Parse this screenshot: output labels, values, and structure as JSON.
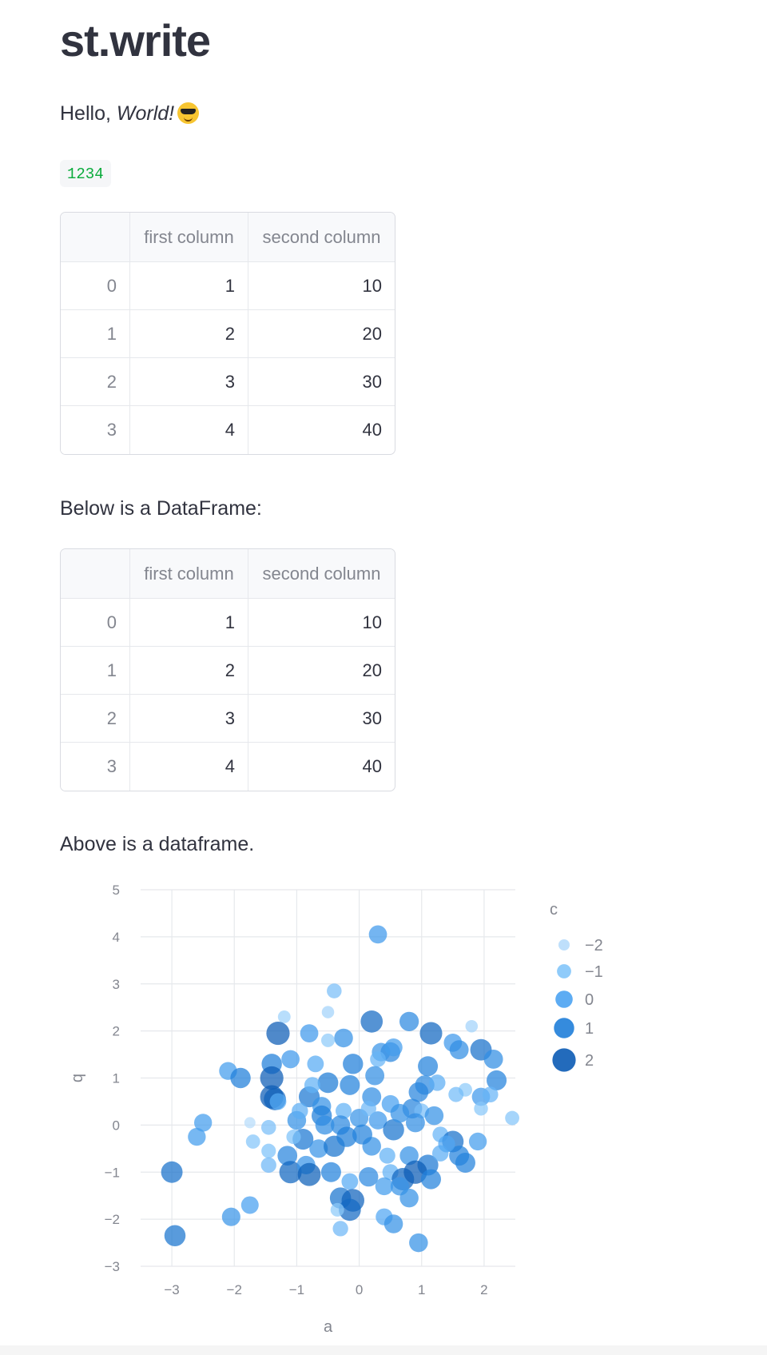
{
  "page": {
    "title": "st.write",
    "hello": {
      "prefix": "Hello, ",
      "italic": "World!"
    },
    "code_value": "1234",
    "caption_below": "Below is a DataFrame:",
    "caption_above": "Above is a dataframe."
  },
  "tables": {
    "columns": [
      "",
      "first column",
      "second column"
    ],
    "rows": [
      {
        "index": "0",
        "first": "1",
        "second": "10"
      },
      {
        "index": "1",
        "first": "2",
        "second": "20"
      },
      {
        "index": "2",
        "first": "3",
        "second": "30"
      },
      {
        "index": "3",
        "first": "4",
        "second": "40"
      }
    ]
  },
  "chart_data": {
    "type": "scatter",
    "xlabel": "a",
    "ylabel": "b",
    "xticks": [
      -3,
      -2,
      -1,
      0,
      1,
      2
    ],
    "yticks": [
      -3,
      -2,
      -1,
      0,
      1,
      2,
      3,
      4,
      5
    ],
    "xlim": [
      -3.5,
      2.5
    ],
    "ylim": [
      -3.0,
      5.0
    ],
    "grid": true,
    "legend": {
      "title": "c",
      "placement": "right",
      "entries": [
        "−2",
        "−1",
        "0",
        "1",
        "2"
      ]
    },
    "colors": {
      "c_minus2": "#b7dcfb",
      "c_minus1": "#83c5fa",
      "c_0": "#4ba3f2",
      "c_1": "#1f7ed9",
      "c_2": "#0b5bb5",
      "grid": "#e6e8ec",
      "axis_text": "#83868f"
    },
    "points": [
      [
        0.3,
        4.05,
        0.3
      ],
      [
        -0.4,
        2.85,
        -0.8
      ],
      [
        -0.5,
        2.4,
        -1.6
      ],
      [
        -1.2,
        2.3,
        -1.5
      ],
      [
        0.2,
        2.2,
        1.6
      ],
      [
        -1.3,
        1.95,
        2.0
      ],
      [
        -0.8,
        1.95,
        0.3
      ],
      [
        -0.25,
        1.85,
        0.5
      ],
      [
        0.8,
        2.2,
        0.7
      ],
      [
        1.15,
        1.95,
        1.7
      ],
      [
        1.8,
        2.1,
        -1.6
      ],
      [
        1.5,
        1.75,
        0.3
      ],
      [
        1.6,
        1.6,
        0.6
      ],
      [
        1.95,
        1.6,
        1.4
      ],
      [
        2.15,
        1.4,
        0.6
      ],
      [
        0.5,
        1.55,
        0.8
      ],
      [
        0.35,
        1.55,
        0.4
      ],
      [
        0.55,
        1.65,
        0.2
      ],
      [
        -0.5,
        1.8,
        -1.2
      ],
      [
        -1.1,
        1.4,
        0.3
      ],
      [
        -0.7,
        1.3,
        -0.2
      ],
      [
        -1.4,
        1.3,
        1.0
      ],
      [
        -0.1,
        1.3,
        1.0
      ],
      [
        0.3,
        1.4,
        -0.5
      ],
      [
        1.1,
        1.25,
        0.9
      ],
      [
        -2.1,
        1.15,
        0.2
      ],
      [
        -1.9,
        1.0,
        1.0
      ],
      [
        -1.4,
        1.0,
        2.0
      ],
      [
        -0.5,
        0.9,
        1.1
      ],
      [
        -0.15,
        0.85,
        0.9
      ],
      [
        0.25,
        1.05,
        0.6
      ],
      [
        1.05,
        0.85,
        0.7
      ],
      [
        1.25,
        0.9,
        -0.3
      ],
      [
        1.7,
        0.75,
        -1.2
      ],
      [
        2.2,
        0.95,
        0.9
      ],
      [
        1.95,
        0.6,
        0.3
      ],
      [
        2.1,
        0.65,
        -0.5
      ],
      [
        1.55,
        0.65,
        -0.7
      ],
      [
        -1.35,
        0.55,
        1.6
      ],
      [
        -1.4,
        0.6,
        2.2
      ],
      [
        -1.3,
        0.5,
        -0.2
      ],
      [
        -0.8,
        0.6,
        1.2
      ],
      [
        -0.6,
        0.4,
        0.5
      ],
      [
        -0.25,
        0.3,
        -0.4
      ],
      [
        0.2,
        0.6,
        0.6
      ],
      [
        0.5,
        0.45,
        0.1
      ],
      [
        0.85,
        0.35,
        0.8
      ],
      [
        1.0,
        0.3,
        -0.8
      ],
      [
        1.2,
        0.2,
        0.5
      ],
      [
        1.95,
        0.35,
        -1.1
      ],
      [
        2.45,
        0.15,
        -1.0
      ],
      [
        -2.5,
        0.05,
        0.2
      ],
      [
        -2.6,
        -0.25,
        0.2
      ],
      [
        -1.45,
        -0.05,
        -0.8
      ],
      [
        -1.75,
        0.05,
        -2.0
      ],
      [
        -1.0,
        0.1,
        0.5
      ],
      [
        -0.6,
        0.2,
        1.0
      ],
      [
        -0.3,
        0.0,
        0.7
      ],
      [
        0.0,
        0.15,
        0.4
      ],
      [
        0.3,
        0.1,
        0.3
      ],
      [
        0.55,
        -0.1,
        1.3
      ],
      [
        0.9,
        0.05,
        0.6
      ],
      [
        1.3,
        -0.2,
        -0.5
      ],
      [
        1.5,
        -0.35,
        1.4
      ],
      [
        1.9,
        -0.35,
        0.2
      ],
      [
        -1.7,
        -0.35,
        -1.0
      ],
      [
        -1.45,
        -0.55,
        -0.9
      ],
      [
        -1.15,
        -0.65,
        0.8
      ],
      [
        -0.9,
        -0.3,
        1.2
      ],
      [
        -0.65,
        -0.5,
        0.4
      ],
      [
        -0.4,
        -0.45,
        1.3
      ],
      [
        -0.2,
        -0.25,
        1.0
      ],
      [
        0.2,
        -0.45,
        0.5
      ],
      [
        0.45,
        -0.65,
        -0.4
      ],
      [
        0.8,
        -0.65,
        0.5
      ],
      [
        1.1,
        -0.85,
        1.2
      ],
      [
        1.3,
        -0.6,
        -0.3
      ],
      [
        1.6,
        -0.65,
        0.9
      ],
      [
        1.7,
        -0.8,
        0.9
      ],
      [
        -1.45,
        -0.85,
        -0.6
      ],
      [
        -1.1,
        -1.0,
        1.7
      ],
      [
        -0.85,
        -0.85,
        0.4
      ],
      [
        -0.8,
        -1.05,
        1.9
      ],
      [
        -0.45,
        -1.0,
        0.9
      ],
      [
        -0.15,
        -1.2,
        -0.2
      ],
      [
        0.15,
        -1.1,
        0.7
      ],
      [
        0.5,
        -1.0,
        -0.4
      ],
      [
        0.7,
        -1.15,
        1.7
      ],
      [
        0.9,
        -1.0,
        2.1
      ],
      [
        1.15,
        -1.15,
        0.9
      ],
      [
        -0.3,
        -1.55,
        1.3
      ],
      [
        -0.1,
        -1.6,
        1.8
      ],
      [
        -0.15,
        -1.8,
        1.6
      ],
      [
        -0.35,
        -1.8,
        -1.2
      ],
      [
        0.4,
        -1.3,
        0.2
      ],
      [
        0.65,
        -1.3,
        0.4
      ],
      [
        0.8,
        -1.55,
        0.5
      ],
      [
        0.4,
        -1.95,
        -0.1
      ],
      [
        0.55,
        -2.1,
        0.5
      ],
      [
        -0.3,
        -2.2,
        -0.6
      ],
      [
        -3.0,
        -1.0,
        1.4
      ],
      [
        -2.95,
        -2.35,
        1.3
      ],
      [
        -2.05,
        -1.95,
        0.4
      ],
      [
        -1.75,
        -1.7,
        0.1
      ],
      [
        0.95,
        -2.5,
        0.5
      ],
      [
        -1.05,
        -0.25,
        -0.9
      ],
      [
        -0.55,
        0.0,
        0.6
      ],
      [
        0.05,
        -0.2,
        0.9
      ],
      [
        0.65,
        0.25,
        0.5
      ],
      [
        -0.75,
        0.85,
        -0.4
      ],
      [
        0.95,
        0.7,
        0.8
      ],
      [
        1.4,
        -0.4,
        -0.1
      ],
      [
        -0.95,
        0.3,
        -0.3
      ],
      [
        0.15,
        0.35,
        -0.6
      ]
    ]
  }
}
